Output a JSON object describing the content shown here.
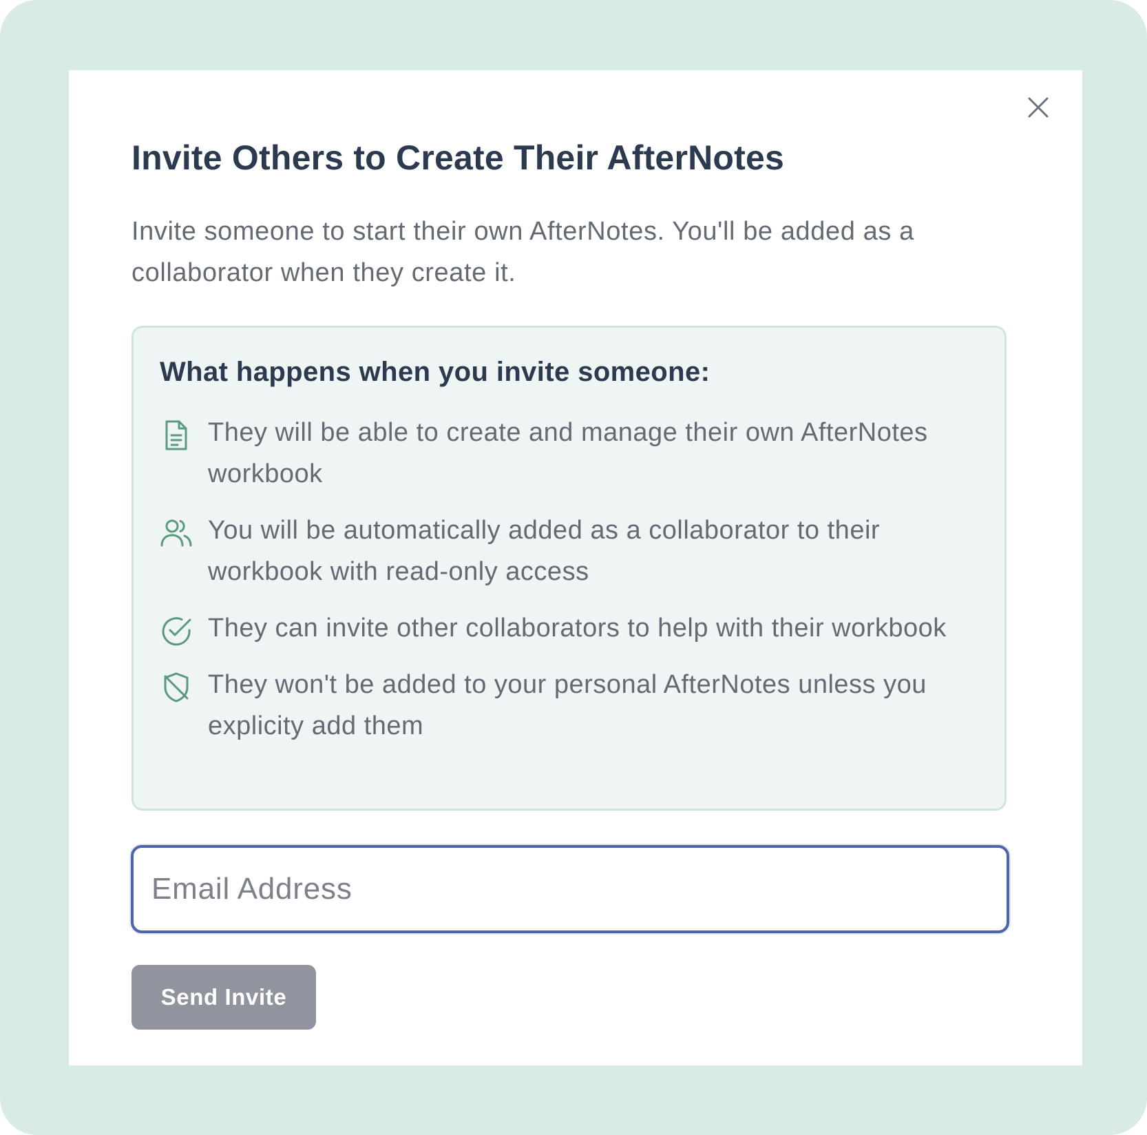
{
  "modal": {
    "title": "Invite Others to Create Their AfterNotes",
    "subtitle": "Invite someone to start their own AfterNotes. You'll be added as a collaborator when they create it.",
    "close_icon": "close-icon"
  },
  "info": {
    "heading": "What happens when you invite someone:",
    "items": [
      {
        "icon": "document-icon",
        "text": "They will be able to create and manage their own AfterNotes workbook"
      },
      {
        "icon": "users-icon",
        "text": "You will be automatically added as a collaborator to their workbook with read-only access"
      },
      {
        "icon": "check-circle-icon",
        "text": "They can invite other collaborators to help with their workbook"
      },
      {
        "icon": "shield-off-icon",
        "text": "They won't be added to your personal AfterNotes unless you explicity add them"
      }
    ]
  },
  "form": {
    "email_placeholder": "Email Address",
    "email_value": "",
    "send_label": "Send Invite"
  },
  "colors": {
    "background": "#d8ebe4",
    "icon": "#5a9a7c",
    "input_focus": "#4f63a8",
    "button_disabled": "#8f949e"
  }
}
